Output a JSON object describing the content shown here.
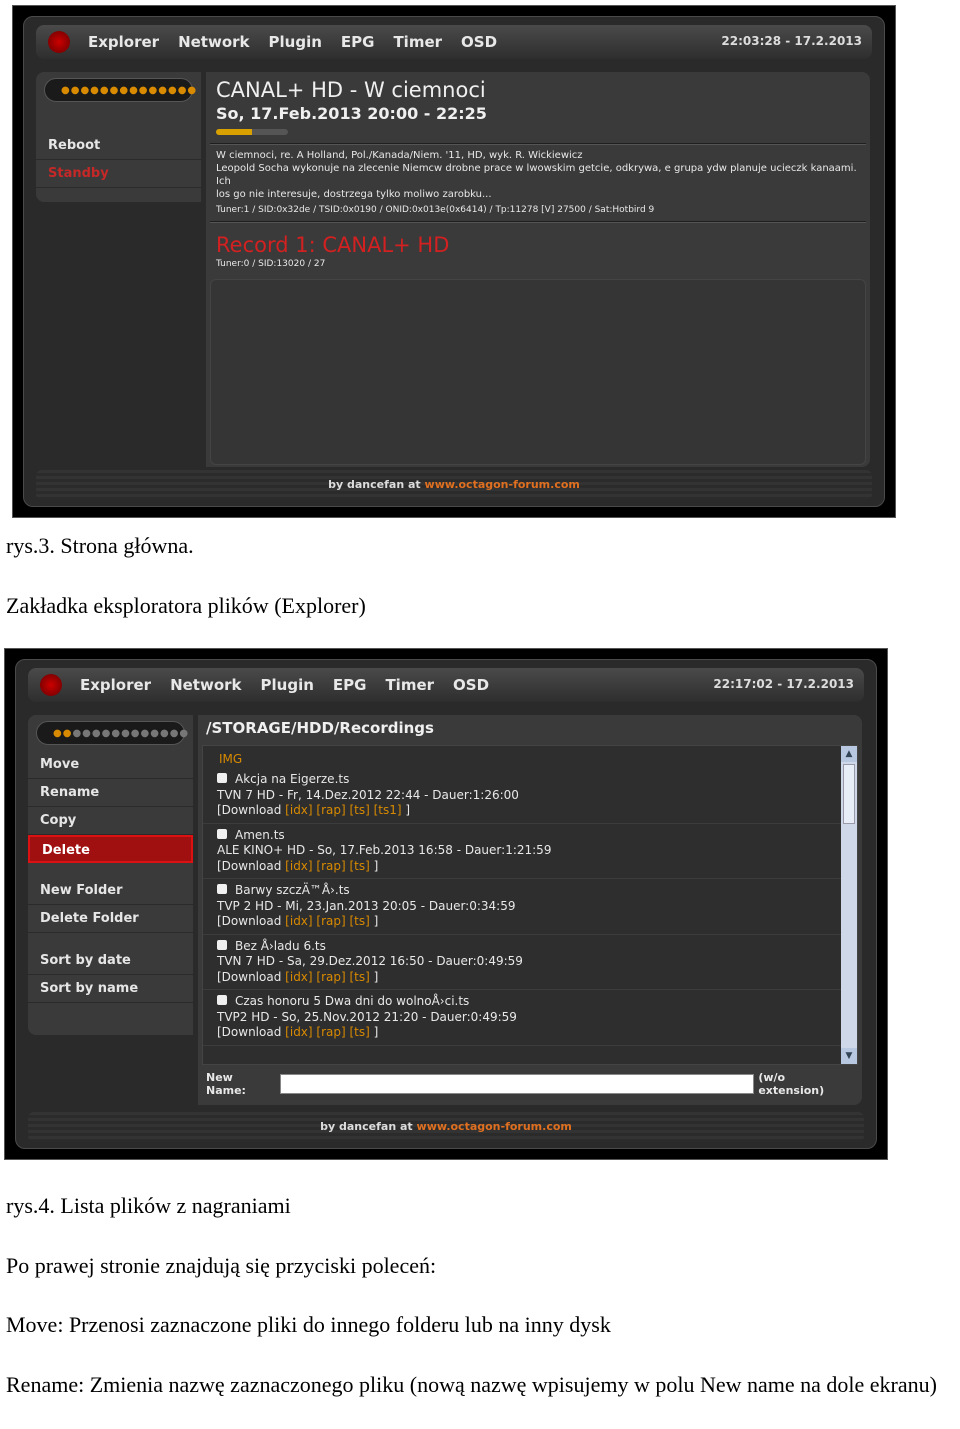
{
  "nav": [
    "Explorer",
    "Network",
    "Plugin",
    "EPG",
    "Timer",
    "OSD"
  ],
  "footer": {
    "by": "by dancefan at",
    "link": "www.octagon-forum.com"
  },
  "shot1": {
    "clock": "22:03:28 - 17.2.2013",
    "side_items": [
      "Reboot",
      "Standby"
    ],
    "title": "CANAL+ HD - W ciemnoci",
    "date": "So, 17.Feb.2013 20:00 - 22:25",
    "progress_fraction": 0.5,
    "desc": [
      "W ciemnoci, re. A Holland, Pol./Kanada/Niem. '11, HD, wyk. R. Wickiewicz",
      "Leopold Socha wykonuje na zlecenie Niemcw drobne prace w lwowskim getcie, odkrywa, e grupa ydw planuje ucieczk kanaami. Ich",
      "los go nie interesuje, dostrzega tylko moliwo zarobku..."
    ],
    "tech": "Tuner:1 / SID:0x32de / TSID:0x0190 / ONID:0x013e(0x6414) / Tp:11278 [V] 27500 / Sat:Hotbird 9",
    "record": "Record 1: CANAL+ HD",
    "record_tech": "Tuner:0 / SID:13020 / 27"
  },
  "caption1": "rys.3. Strona główna.",
  "heading_explorer": "Zakładka eksploratora plików (Explorer)",
  "shot2": {
    "clock": "22:17:02 - 17.2.2013",
    "side_group1": [
      "Move",
      "Rename",
      "Copy",
      "Delete"
    ],
    "side_group2": [
      "New Folder",
      "Delete Folder"
    ],
    "side_group3": [
      "Sort by date",
      "Sort by name"
    ],
    "path": "/STORAGE/HDD/Recordings",
    "img_folder": "IMG",
    "files": [
      {
        "name": "Akcja na Eigerze.ts",
        "info": "TVN 7 HD   -   Fr, 14.Dez.2012 22:44   -  Dauer:1:26:00",
        "dl": "[Download",
        "links": "[idx]  [rap]  [ts]  [ts1]",
        "end": " ]"
      },
      {
        "name": "Amen.ts",
        "info": "ALE KINO+ HD   -   So, 17.Feb.2013 16:58   -  Dauer:1:21:59",
        "dl": "[Download",
        "links": "[idx]  [rap]  [ts]",
        "end": " ]"
      },
      {
        "name": "Barwy szczÄ™Å›.ts",
        "info": "TVP 2 HD   -   Mi, 23.Jan.2013 20:05   -  Dauer:0:34:59",
        "dl": "[Download",
        "links": "[idx]  [rap]  [ts]",
        "end": " ]"
      },
      {
        "name": "Bez Å›ladu 6.ts",
        "info": "TVN 7 HD   -   Sa, 29.Dez.2012 16:50   -  Dauer:0:49:59",
        "dl": "[Download",
        "links": "[idx]  [rap]  [ts]",
        "end": " ]"
      },
      {
        "name": "Czas honoru 5 Dwa dni do wolnoÅ›ci.ts",
        "info": "TVP2 HD   -   So, 25.Nov.2012 21:20   -  Dauer:0:49:59",
        "dl": "[Download",
        "links": "[idx]  [rap]  [ts]",
        "end": " ]"
      }
    ],
    "new_name_label": "New Name:",
    "new_name_suffix": "(w/o extension)"
  },
  "caption2": "rys.4. Lista plików z nagraniami",
  "para1": "Po prawej stronie znajdują się przyciski poleceń:",
  "para2": "Move: Przenosi zaznaczone pliki do innego folderu lub na inny dysk",
  "para3": "Rename: Zmienia nazwę zaznaczonego pliku (nową nazwę wpisujemy w polu New name na dole ekranu)"
}
